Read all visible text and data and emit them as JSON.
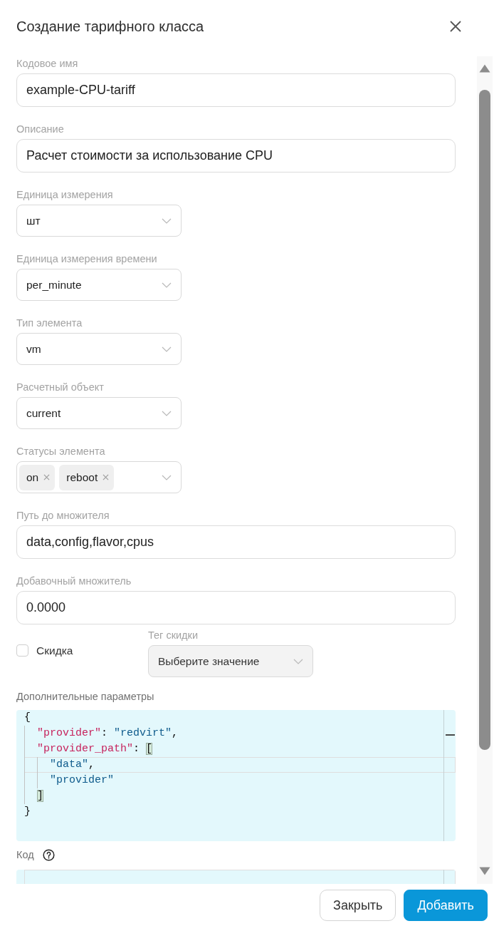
{
  "dialog": {
    "title": "Создание тарифного класса"
  },
  "fields": [
    {
      "kind": "text",
      "label": "Кодовое имя",
      "value": "example-CPU-tariff"
    },
    {
      "kind": "text",
      "label": "Описание",
      "value": "Расчет стоимости за использование CPU"
    },
    {
      "kind": "select",
      "label": "Единица измерения",
      "value": "шт"
    },
    {
      "kind": "select",
      "label": "Единица измерения времени",
      "value": "per_minute"
    },
    {
      "kind": "select",
      "label": "Тип элемента",
      "value": "vm"
    },
    {
      "kind": "select",
      "label": "Расчетный объект",
      "value": "current"
    },
    {
      "kind": "multiselect",
      "label": "Статусы элемента",
      "tags": [
        "on",
        "reboot"
      ]
    },
    {
      "kind": "text",
      "label": "Путь до множителя",
      "value": "data,config,flavor,cpus"
    },
    {
      "kind": "text",
      "label": "Добавочный множитель",
      "value": "0.0000"
    }
  ],
  "discount": {
    "label": "Скидка",
    "checked": false
  },
  "discount_tag": {
    "label": "Тег скидки",
    "placeholder": "Выберите значение",
    "disabled": true
  },
  "editors": [
    {
      "label": "Дополнительные параметры",
      "help": false,
      "lines": [
        {
          "tokens": [
            {
              "text": "{",
              "kind": "punct"
            }
          ],
          "active": false
        },
        {
          "tokens": [
            {
              "text": "  \"provider\"",
              "kind": "key"
            },
            {
              "text": ": ",
              "kind": "punct"
            },
            {
              "text": "\"redvirt\"",
              "kind": "string"
            },
            {
              "text": ",",
              "kind": "punct"
            }
          ],
          "active": false
        },
        {
          "tokens": [
            {
              "text": "  \"provider_path\"",
              "kind": "key"
            },
            {
              "text": ": ",
              "kind": "punct"
            },
            {
              "text": "[",
              "kind": "match"
            }
          ],
          "active": false
        },
        {
          "tokens": [
            {
              "text": "    \"data\"",
              "kind": "string"
            },
            {
              "text": ",",
              "kind": "punct"
            }
          ],
          "active": true
        },
        {
          "tokens": [
            {
              "text": "    \"provider\"",
              "kind": "string"
            }
          ],
          "active": false
        },
        {
          "tokens": [
            {
              "text": "  ]",
              "kind": "match"
            }
          ],
          "active": false
        },
        {
          "tokens": [
            {
              "text": "}",
              "kind": "punct"
            }
          ],
          "active": false
        }
      ]
    },
    {
      "label": "Код",
      "help": true,
      "lines": [
        {
          "active": true
        }
      ]
    }
  ],
  "buttons": [
    {
      "label": "Закрыть",
      "kind": "secondary"
    },
    {
      "label": "Добавить",
      "kind": "primary"
    }
  ]
}
